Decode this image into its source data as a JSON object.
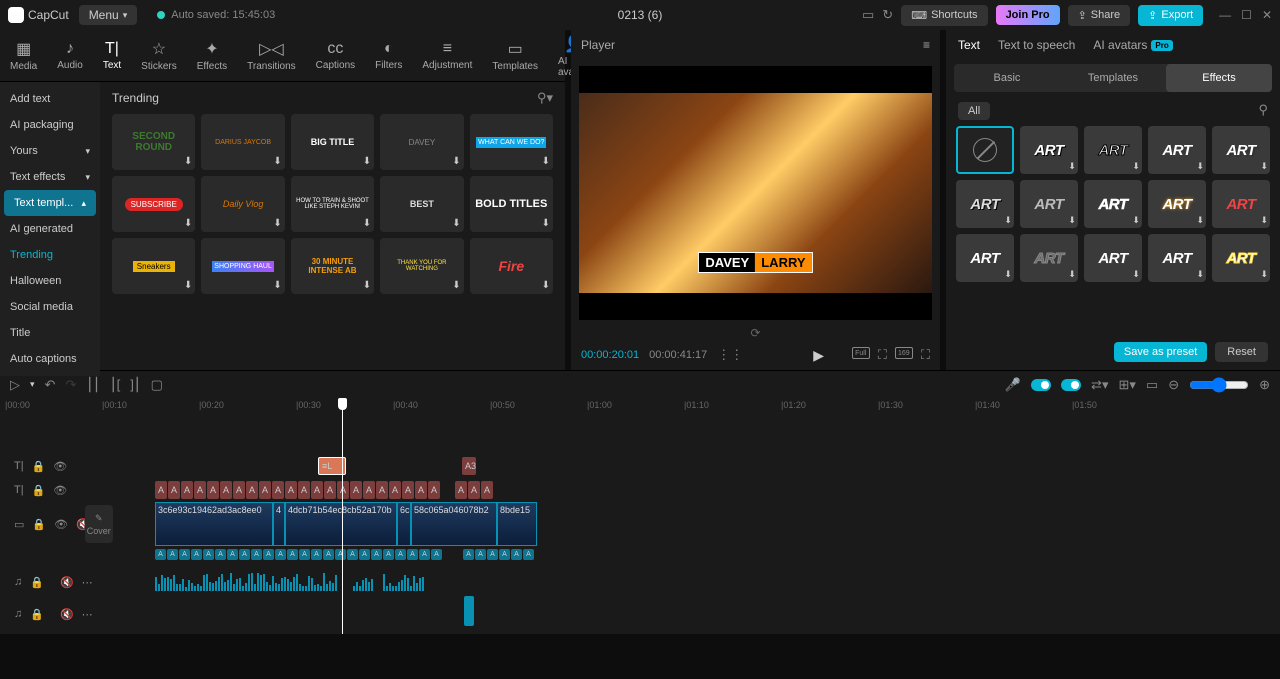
{
  "app": {
    "name": "CapCut",
    "menu": "Menu",
    "autosave": "Auto saved: 15:45:03",
    "title": "0213 (6)"
  },
  "topbtns": {
    "shortcuts": "Shortcuts",
    "joinpro": "Join Pro",
    "share": "Share",
    "export": "Export"
  },
  "tools": [
    "Media",
    "Audio",
    "Text",
    "Stickers",
    "Effects",
    "Transitions",
    "Captions",
    "Filters",
    "Adjustment",
    "Templates",
    "AI avatars"
  ],
  "tool_active_index": 2,
  "sidebar": {
    "items": [
      "Add text",
      "AI packaging",
      "Yours",
      "Text effects",
      "Text templ...",
      "AI generated",
      "Trending",
      "Halloween",
      "Social media",
      "Title",
      "Auto captions"
    ],
    "highlighted_index": 4,
    "active_index": 6
  },
  "content_heading": "Trending",
  "thumbs": [
    {
      "label": "SECOND ROUND",
      "style": "color:#3d7a2e;font-weight:900;font-size:10px;"
    },
    {
      "label": "DARIUS JAYCOB",
      "style": "color:#d97706;font-size:7px;"
    },
    {
      "label": "BIG TITLE",
      "style": "color:#fff;font-weight:900;"
    },
    {
      "label": "DAVEY",
      "style": "color:#888;font-size:8px;"
    },
    {
      "label": "WHAT CAN WE DO?",
      "style": "background:#0ea5e9;color:#fff;font-size:7px;padding:2px;"
    },
    {
      "label": "SUBSCRIBE",
      "style": "background:#dc2626;color:#fff;border-radius:8px;padding:2px 6px;font-size:8px;"
    },
    {
      "label": "Daily Vlog",
      "style": "color:#d97706;font-style:italic;"
    },
    {
      "label": "HOW TO TRAIN & SHOOT LIKE STEPH KEVIN!",
      "style": "color:#fff;font-size:6px;"
    },
    {
      "label": "BEST",
      "style": "color:#ddd;font-weight:bold;"
    },
    {
      "label": "BOLD TITLES",
      "style": "color:#fff;font-weight:900;font-size:11px;"
    },
    {
      "label": "Sneakers",
      "style": "background:#eab308;color:#000;padding:1px 4px;font-size:8px;"
    },
    {
      "label": "SHOPPING HAUL",
      "style": "background:linear-gradient(90deg,#3b82f6,#a855f7);color:#fff;font-size:7px;padding:2px;"
    },
    {
      "label": "30 MINUTE INTENSE AB",
      "style": "color:#f59e0b;font-size:8px;font-weight:bold;"
    },
    {
      "label": "THANK YOU FOR WATCHING",
      "style": "color:#fde047;font-size:6px;"
    },
    {
      "label": "Fire",
      "style": "color:#ef4444;font-weight:900;font-size:14px;font-style:italic;"
    }
  ],
  "player": {
    "title": "Player",
    "text1": "DAVEY",
    "text2": "LARRY",
    "time_current": "00:00:20:01",
    "time_total": "00:00:41:17",
    "badges": [
      "Full",
      "169"
    ]
  },
  "rightpanel": {
    "tabs": [
      "Text",
      "Text to speech",
      "AI avatars"
    ],
    "tabs_active": 0,
    "subtabs": [
      "Basic",
      "Templates",
      "Effects"
    ],
    "subtabs_active": 2,
    "filter": "All",
    "art_label": "ART",
    "art_styles": [
      "none",
      "color:#fff;text-shadow:1px 1px #000;",
      "color:#fff;-webkit-text-stroke:1px #000;",
      "color:#fff;",
      "color:#fff;text-shadow:2px 2px #333;",
      "color:#ddd;text-shadow:1px 1px #000;",
      "color:#bbb;",
      "color:#fff;-webkit-text-stroke:0.5px #fff;",
      "color:#fff;text-shadow:0 0 3px #f59e0b;",
      "color:#ef4444;",
      "color:#fff;",
      "color:#666;-webkit-text-stroke:1px #888;",
      "color:#fff;text-shadow:1px 1px #444;",
      "color:#fff;",
      "color:#fff;-webkit-text-stroke:1px #fde047;"
    ],
    "save_preset": "Save as preset",
    "reset": "Reset"
  },
  "timeline": {
    "marks": [
      "|00:00",
      "|00:10",
      "|00:20",
      "|00:30",
      "|00:40",
      "|00:50",
      "|01:00",
      "|01:10",
      "|01:20",
      "|01:30",
      "|01:40",
      "|01:50"
    ],
    "cover": "Cover",
    "clips": [
      "3c6e93c19462ad3ac8ee0",
      "4",
      "4dcb71b54ec8cb52a170b",
      "6c",
      "58c065a046078b2",
      "8bde15"
    ],
    "clip_widths": [
      118,
      12,
      112,
      14,
      86,
      40
    ],
    "text_track_count": 25,
    "caption_count": 30,
    "sel_clip_label": "L",
    "a3_label": "A3"
  }
}
